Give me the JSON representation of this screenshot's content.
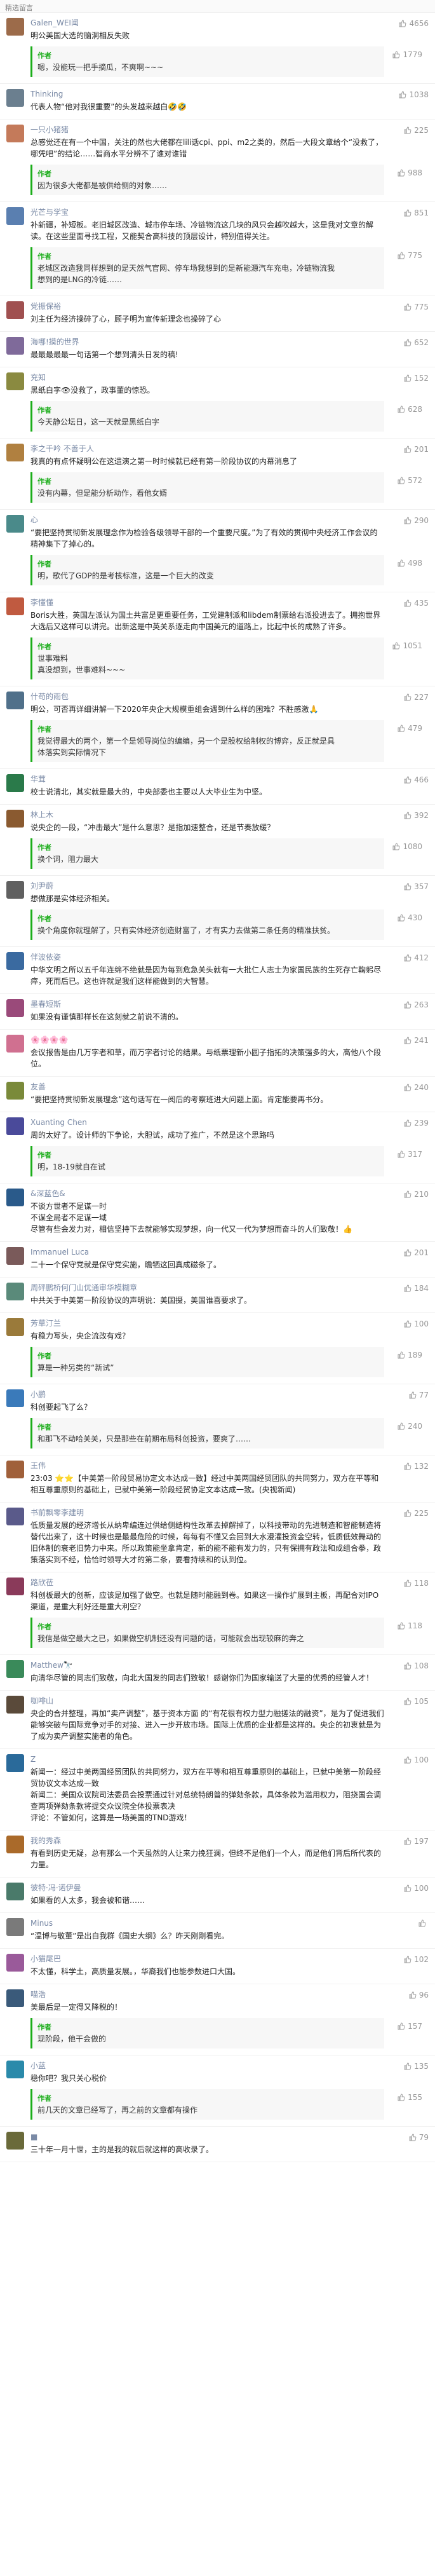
{
  "header": {
    "title": "精选留言"
  },
  "author_label": "作者",
  "comments": [
    {
      "name": "Galen_WEI闻",
      "likes": "4656",
      "text": "明公美国大选的脑洞相反失败",
      "color": "#9c6b4a",
      "reply": {
        "text": "嗯，没能玩一把手摘瓜，不爽啊~~~",
        "likes": "1779"
      }
    },
    {
      "name": "Thinking",
      "likes": "1038",
      "text": "代表人物“他对我很重要”的头发越来越白🤣🤣",
      "color": "#6b7f8f"
    },
    {
      "name": "一只小猪猪",
      "likes": "225",
      "text": "总感觉还在有一个中国，关注的然也大佬都在lili话cpi、ppi、m2之类的，然后一大段文章给个“没救了，哪凭吧”的结论……智商水平分辨不了谁对谁错",
      "color": "#c47a5a",
      "reply": {
        "text": "因为很多大佬都是被供给侧的对象……",
        "likes": "988"
      }
    },
    {
      "name": "光芒与学宝",
      "likes": "851",
      "text": "补新疆，补短板。老旧城区改造、城市停车场、冷链物流这几块的风只会越吹越大，这是我对文章的解读。在这些里面寻找工程，又能契合高科技的顶层设计，特别值得关注。",
      "color": "#5a7fb0",
      "reply": {
        "text": "老城区改造我同样想到的是天然气官网、停车场我想到的是新能源汽车充电，冷链物流我想到的是LNG的冷链……",
        "likes": "775"
      }
    },
    {
      "name": "党振保裕",
      "likes": "775",
      "text": "刘主任为经济操碎了心，顾子明为宣传新理念也操碎了心",
      "color": "#a05050"
    },
    {
      "name": "海哪!摸的世界",
      "likes": "652",
      "text": "最最最最最一句话第一个想到清头日发的稿!",
      "color": "#7f6a9a"
    },
    {
      "name": "充知",
      "likes": "152",
      "text": "黑纸白字👁没救了，政事董的惊恐。",
      "color": "#8a8a40",
      "reply": {
        "text": "今天静公坛日，这一天就是黑纸白字",
        "likes": "628"
      }
    },
    {
      "name": "李之千吟 不善于人",
      "likes": "201",
      "text": "我真的有点怀疑明公在这遗演之第一时时候就已经有第一阶段协议的内幕消息了",
      "color": "#b08040",
      "reply": {
        "text": "没有内幕，但是能分析动作，看他女婿",
        "likes": "572"
      }
    },
    {
      "name": "心",
      "likes": "290",
      "text": "“要把坚持贯彻新发展理念作为检验各级领导干部的一个重要尺度。”为了有效的贯彻中央经济工作会议的精神集下了掉心的。",
      "color": "#4a8a8a",
      "reply": {
        "text": "明，歌代了GDP的是考核标准，这是一个巨大的改变",
        "likes": "498"
      }
    },
    {
      "name": "李懂懂",
      "likes": "435",
      "text": "Boris大胜，英国左派认为国土共富是更重要任务，工党建制派和libdem制票给右派投进去了。拥抱世界大选后又这样可以讲完。出新这是中英关系逐走向中国美元的道路上，比起中长的成熟了许多。",
      "color": "#c05a40",
      "reply": {
        "text": "世事难料\n真没想到，世事难料~~~",
        "likes": "1051"
      }
    },
    {
      "name": "什苟的雨包",
      "likes": "227",
      "text": "明公，可否再详细讲解一下2020年央企大规模重组会遇到什么样的困难？不胜感激🙏",
      "color": "#50708a",
      "reply": {
        "text": "我觉得最大的两个，第一个是领导岗位的编编，另一个是股权给制权的博弈，反正就是具体落实到实际情况下",
        "likes": "479"
      }
    },
    {
      "name": "华茸",
      "likes": "466",
      "text": "校士说清北，其实就是最大的，中央部委也主要以人大毕业生为中坚。",
      "color": "#2a7a4a"
    },
    {
      "name": "林上木",
      "likes": "392",
      "text": "说央企的一段，“冲击最大”是什么意思？是指加速整合，还是节奏放缓？",
      "color": "#8a5a30",
      "reply": {
        "text": "换个词，阻力最大",
        "likes": "1080"
      }
    },
    {
      "name": "刘尹蔚",
      "likes": "357",
      "text": "想做那是实体经济相关。",
      "color": "#606060",
      "reply": {
        "text": "换个角度你就理解了，只有实体经济创造财富了，才有实力去做第二条任务的精准扶贫。",
        "likes": "430"
      }
    },
    {
      "name": "伴波依姿",
      "likes": "412",
      "text": "中华文明之所以五千年连绵不绝就是因为每到危急关头就有一大批仁人志士为家国民族的生死存亡鞠躬尽瘁，死而后已。这也许就是我们这样能做到的大智慧。",
      "color": "#3a6aa0"
    },
    {
      "name": "墨春短斯",
      "likes": "263",
      "text": "如果没有谨慎那样长在这刻就之前说不清的。",
      "color": "#9a4a7a"
    },
    {
      "name": "🌸🌸🌸🌸",
      "likes": "241",
      "text": "会议报告是由几万字者和草，而万字者讨论的结果。与纸票理新小圆子指拓的决策强多的大，高他八个段位。",
      "color": "#d07090"
    },
    {
      "name": "友善",
      "likes": "240",
      "text": "“要把坚持贯彻新发展理念”这句话写在一阅后的考察班进大问题上面。肯定能要再书分。",
      "color": "#7a8a3a"
    },
    {
      "name": "Xuanting Chen",
      "likes": "239",
      "text": "周的太好了。设计师的下争论，大胆试，成功了推广，不然是这个思路吗",
      "color": "#4a4a9a",
      "reply": {
        "text": "明，18-19就自在试",
        "likes": "317"
      }
    },
    {
      "name": "&深蓝色&",
      "likes": "210",
      "text": "不谈方世者不是谋一时\n不谋全局者不足谋一域\n尽管有些会发力对，相信坚持下去就能够实现梦想，向一代又一代为梦想而奋斗的人们致敬！👍",
      "color": "#2a5a8a"
    },
    {
      "name": "Immanuel Luca",
      "likes": "201",
      "text": "二十一个保守党就是保守党实施，瞻牺这回真成磁条了。",
      "color": "#7a5a5a"
    },
    {
      "name": "周砰鹏桥何门山优通审华模糊章",
      "likes": "184",
      "text": "中共关于中美第一阶段协议的声明说：美国摄，美国谁喜要求了。",
      "color": "#5a8a7a"
    },
    {
      "name": "芳草汀兰",
      "likes": "100",
      "text": "有稳力写头，央企流改有戏？",
      "color": "#9a7a3a",
      "reply": {
        "text": "算是一种另类的“新试”",
        "likes": "189"
      }
    },
    {
      "name": "小鹏",
      "likes": "77",
      "text": "科创要起飞了么？",
      "color": "#3a7aba",
      "reply": {
        "text": "和那飞不动哈关关，只是那些在前期布局科创投资，要爽了……",
        "likes": "240"
      }
    },
    {
      "name": "王伟",
      "likes": "132",
      "text": "23:03 ⭐⭐【中美第一阶段贸易协定文本达成一致】经过中美两国经贸团队的共同努力，双方在平等和相互尊重原则的基础上，已就中美第一阶段经贸协定文本达成一致。(央视新闻)",
      "color": "#a0603a"
    },
    {
      "name": "书前飘零李建明",
      "likes": "225",
      "text": "低质量发展的经济增长从纳卑编连过供给侧结构性改革去掉解掉了，以科技带动的先进制造和智能制造将替代出来了，这十时候也是最最危险的时候，每每有不懂又会回到大水漫灌投资金空转，低质低效舞动的旧体制的衰老旧势力中来。所以政策能坐拿肯定，新的能不能有发力的，只有保拥有政法和成组合拳，政策落实到不经，恰恰时领导大才的第二条，要看持续和的认到位。",
      "color": "#5a5a8a"
    },
    {
      "name": "路欣莅",
      "likes": "118",
      "text": "科创板最大的创新，应该是加强了做空。也就是随时能融到卷。如果这一操作扩展到主板，再配合对IPO渠道，是重大利好还是重大利空？",
      "color": "#8a3a5a",
      "reply": {
        "text": "我信是做空最大之已，如果做空机制还没有问题的话，可能就会出现较麻的奔之",
        "likes": "118"
      }
    },
    {
      "name": "Matthew🔭",
      "likes": "108",
      "text": "向清华尽管的同志们致敬，向北大国发的同志们致敬！感谢你们为国家输送了大量的优秀的经管人才！",
      "color": "#3a8a5a"
    },
    {
      "name": "咖啡山",
      "likes": "105",
      "text": "央企的合并整理，再加“卖产调整”，基于资本方面 的“有花很有权力型力融搓法的融资”，是为了促进我们能够突破与国际竞争对手的对接、进入一步开放市场。国际上优质的企业都是这样的。央企的初衷就是为了成为卖产调整实施者的角色。",
      "color": "#5a4a3a"
    },
    {
      "name": "Z",
      "likes": "100",
      "text": "新闻一：经过中美两国经贸团队的共同努力，双方在平等和相互尊重原则的基础上，已就中美第一阶段经贸协议文本达成一致\n新闻二：美国众议院司法委员会投票通过针对总统特朗普的弹劾条款，具体条款为滥用权力，阻挠国会调查两项弹劾条款将提交众议院全体投票表决\n评论：不管如何，这算是一场美国的TND游戏！",
      "color": "#2a6a9a"
    },
    {
      "name": "我的秀森",
      "likes": "197",
      "text": "有看到历史无疑，总有那么一个天虽然的人让来力挽狂澜，但终不是他们一个人，而是他们背后所代表的力量。",
      "color": "#aa6a2a"
    },
    {
      "name": "彼特·冯·诺伊曼",
      "likes": "100",
      "text": "如果看的人太多，我会被和谐……",
      "color": "#4a7a6a"
    },
    {
      "name": "Minus",
      "likes": "",
      "text": "“温博与敬董”是出自我群《国史大纲》么？昨天刚刚看完。",
      "color": "#7a7a7a"
    },
    {
      "name": "小猫尾巴",
      "likes": "102",
      "text": "不太懂，科学土，高质量发展。，华裔我们也能参数进口大国。",
      "color": "#9a5a9a"
    },
    {
      "name": "喵浩",
      "likes": "96",
      "text": "美最后是一定得又降税的！",
      "color": "#3a5a7a",
      "reply": {
        "text": "现阶段，他干会做的",
        "likes": "157"
      }
    },
    {
      "name": "小蓝",
      "likes": "135",
      "text": "稳你吧？我只关心税价",
      "color": "#2a8aaa",
      "reply": {
        "text": "前几天的文章已经写了，再之前的文章都有操作",
        "likes": "155"
      }
    },
    {
      "name": "■",
      "likes": "79",
      "text": "三十年一月十世，主的是我的就后就这样的高收录了。",
      "color": "#6a6a3a"
    }
  ]
}
